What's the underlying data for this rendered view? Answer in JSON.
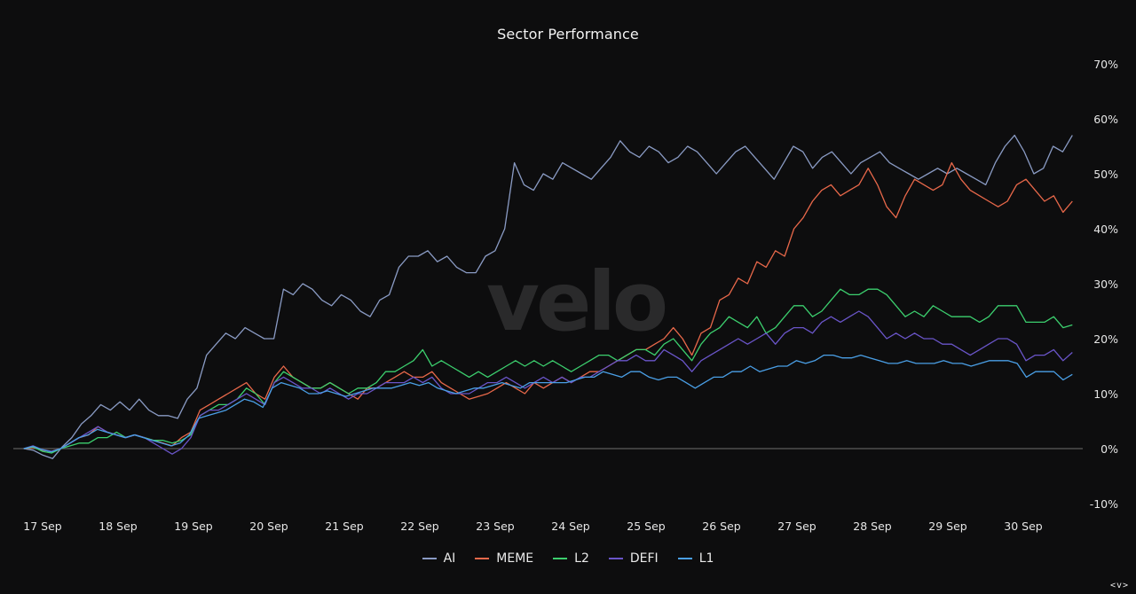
{
  "chart_data": {
    "type": "line",
    "title": "Sector Performance",
    "xlabel": "",
    "ylabel": "",
    "ylim": [
      -10,
      70
    ],
    "y_ticks": [
      "70%",
      "60%",
      "50%",
      "40%",
      "30%",
      "20%",
      "10%",
      "0%",
      "-10%"
    ],
    "y_tick_values": [
      70,
      60,
      50,
      40,
      30,
      20,
      10,
      0,
      -10
    ],
    "x_ticks": [
      "17 Sep",
      "18 Sep",
      "19 Sep",
      "20 Sep",
      "21 Sep",
      "22 Sep",
      "23 Sep",
      "24 Sep",
      "25 Sep",
      "26 Sep",
      "27 Sep",
      "28 Sep",
      "29 Sep",
      "30 Sep"
    ],
    "x_unit": "days since 17 Sep 00:00 (4-hour samples)",
    "x_start": -0.25,
    "x_step": 0.1667,
    "grid": false,
    "zero_line": true,
    "legend_position": "bottom-center",
    "watermark": "velo",
    "series": [
      {
        "name": "AI",
        "color": "#8a9bc4",
        "values": [
          0,
          -0.3,
          -1.2,
          -1.8,
          0.3,
          2,
          4.5,
          6,
          8,
          7,
          8.5,
          7,
          9,
          7,
          6,
          6,
          5.5,
          9,
          11,
          17,
          19,
          21,
          20,
          22,
          21,
          20,
          20,
          29,
          28,
          30,
          29,
          27,
          26,
          28,
          27,
          25,
          24,
          27,
          28,
          33,
          35,
          35,
          36,
          34,
          35,
          33,
          32,
          32,
          35,
          36,
          40,
          52,
          48,
          47,
          50,
          49,
          52,
          51,
          50,
          49,
          51,
          53,
          56,
          54,
          53,
          55,
          54,
          52,
          53,
          55,
          54,
          52,
          50,
          52,
          54,
          55,
          53,
          51,
          49,
          52,
          55,
          54,
          51,
          53,
          54,
          52,
          50,
          52,
          53,
          54,
          52,
          51,
          50,
          49,
          50,
          51,
          50,
          51,
          50,
          49,
          48,
          52,
          55,
          57,
          54,
          50,
          51,
          55,
          54,
          57
        ]
      },
      {
        "name": "MEME",
        "color": "#e8684a",
        "values": [
          0,
          0.2,
          -0.3,
          -0.5,
          0,
          1,
          2,
          2.5,
          4,
          3,
          2.5,
          2,
          2.5,
          2,
          1.5,
          1,
          0.5,
          2,
          3,
          7,
          8,
          9,
          10,
          11,
          12,
          10,
          9,
          13,
          15,
          13,
          12,
          11,
          11,
          12,
          11,
          10,
          9,
          11,
          11,
          12,
          13,
          14,
          13,
          13,
          14,
          12,
          11,
          10,
          9,
          9.5,
          10,
          11,
          12,
          11,
          10,
          12,
          11,
          12,
          13,
          12,
          13,
          14,
          14,
          15,
          16,
          17,
          18,
          18,
          19,
          20,
          22,
          20,
          17,
          21,
          22,
          27,
          28,
          31,
          30,
          34,
          33,
          36,
          35,
          40,
          42,
          45,
          47,
          48,
          46,
          47,
          48,
          51,
          48,
          44,
          42,
          46,
          49,
          48,
          47,
          48,
          52,
          49,
          47,
          46,
          45,
          44,
          45,
          48,
          49,
          47,
          45,
          46,
          43,
          45
        ]
      },
      {
        "name": "L2",
        "color": "#3ccf6e",
        "values": [
          0,
          0.3,
          -0.5,
          -0.8,
          0,
          0.5,
          1,
          1,
          2,
          2,
          3,
          2,
          2.5,
          2,
          1.5,
          1.5,
          1,
          1.5,
          2.5,
          6,
          7,
          8,
          8,
          9,
          11,
          10,
          8,
          12,
          14,
          13,
          12,
          11,
          11,
          12,
          11,
          10,
          11,
          11,
          12,
          14,
          14,
          15,
          16,
          18,
          15,
          16,
          15,
          14,
          13,
          14,
          13,
          14,
          15,
          16,
          15,
          16,
          15,
          16,
          15,
          14,
          15,
          16,
          17,
          17,
          16,
          17,
          18,
          18,
          17,
          19,
          20,
          18,
          16,
          19,
          21,
          22,
          24,
          23,
          22,
          24,
          21,
          22,
          24,
          26,
          26,
          24,
          25,
          27,
          29,
          28,
          28,
          29,
          29,
          28,
          26,
          24,
          25,
          24,
          26,
          25,
          24,
          24,
          24,
          23,
          24,
          26,
          26,
          26,
          23,
          23,
          23,
          24,
          22,
          22.5
        ]
      },
      {
        "name": "DEFI",
        "color": "#6a55c9",
        "values": [
          0,
          0.5,
          -0.2,
          -0.5,
          0,
          1,
          2,
          3,
          4,
          3,
          2.5,
          2,
          2.5,
          2,
          1,
          0,
          -1,
          0,
          2,
          6,
          7,
          7,
          8,
          9,
          10,
          9,
          8,
          12,
          13,
          12,
          11,
          11,
          10,
          11,
          10,
          9,
          10,
          10,
          11,
          12,
          12,
          12,
          13,
          12,
          13,
          11,
          10,
          10,
          10,
          11,
          12,
          12,
          13,
          12,
          11,
          12,
          13,
          12,
          13,
          12,
          13,
          13,
          14,
          15,
          16,
          16,
          17,
          16,
          16,
          18,
          17,
          16,
          14,
          16,
          17,
          18,
          19,
          20,
          19,
          20,
          21,
          19,
          21,
          22,
          22,
          21,
          23,
          24,
          23,
          24,
          25,
          24,
          22,
          20,
          21,
          20,
          21,
          20,
          20,
          19,
          19,
          18,
          17,
          18,
          19,
          20,
          20,
          19,
          16,
          17,
          17,
          18,
          16,
          17.5
        ]
      },
      {
        "name": "L1",
        "color": "#4a9fe6",
        "values": [
          0,
          0.4,
          -0.2,
          -0.6,
          0,
          1,
          2,
          2.5,
          3.5,
          3,
          2.5,
          2,
          2.5,
          2,
          1.5,
          1,
          0.5,
          1,
          2.5,
          5.5,
          6,
          6.5,
          7,
          8,
          9,
          8.5,
          7.5,
          11,
          12,
          11.5,
          11,
          10,
          10,
          10.5,
          10,
          9.5,
          10,
          10.5,
          11,
          11,
          11,
          11.5,
          12,
          11.5,
          12,
          11,
          10.5,
          10,
          10.5,
          11,
          11,
          11.5,
          12,
          11.5,
          11,
          12,
          12,
          12,
          12,
          12,
          12.5,
          13,
          13,
          14,
          13.5,
          13,
          14,
          14,
          13,
          12.5,
          13,
          13,
          12,
          11,
          12,
          13,
          13,
          14,
          14,
          15,
          14,
          14.5,
          15,
          15,
          16,
          15.5,
          16,
          17,
          17,
          16.5,
          16.5,
          17,
          16.5,
          16,
          15.5,
          15.5,
          16,
          15.5,
          15.5,
          15.5,
          16,
          15.5,
          15.5,
          15,
          15.5,
          16,
          16,
          16,
          15.5,
          13,
          14,
          14,
          14,
          12.5,
          13.5
        ]
      }
    ]
  },
  "controls": {
    "nav_label": "<v>"
  }
}
